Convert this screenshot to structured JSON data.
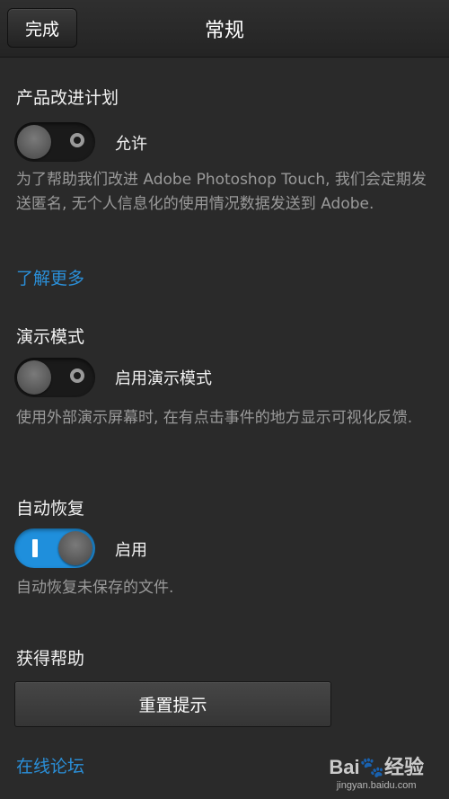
{
  "header": {
    "done_label": "完成",
    "title": "常规"
  },
  "product_improvement": {
    "title": "产品改进计划",
    "toggle_label": "允许",
    "toggle_on": false,
    "description": "为了帮助我们改进 Adobe Photoshop Touch, 我们会定期发送匿名, 无个人信息化的使用情况数据发送到 Adobe.",
    "learn_more": "了解更多"
  },
  "demo_mode": {
    "title": "演示模式",
    "toggle_label": "启用演示模式",
    "toggle_on": false,
    "description": "使用外部演示屏幕时, 在有点击事件的地方显示可视化反馈."
  },
  "auto_recovery": {
    "title": "自动恢复",
    "toggle_label": "启用",
    "toggle_on": true,
    "description": "自动恢复未保存的文件."
  },
  "help": {
    "title": "获得帮助",
    "reset_tips_label": "重置提示",
    "forum_link": "在线论坛"
  },
  "watermark": {
    "main": "Bai🐾经验",
    "sub": "jingyan.baidu.com"
  },
  "colors": {
    "background": "#2a2a2a",
    "accent": "#1f8fdc",
    "link": "#2a8fd8"
  }
}
